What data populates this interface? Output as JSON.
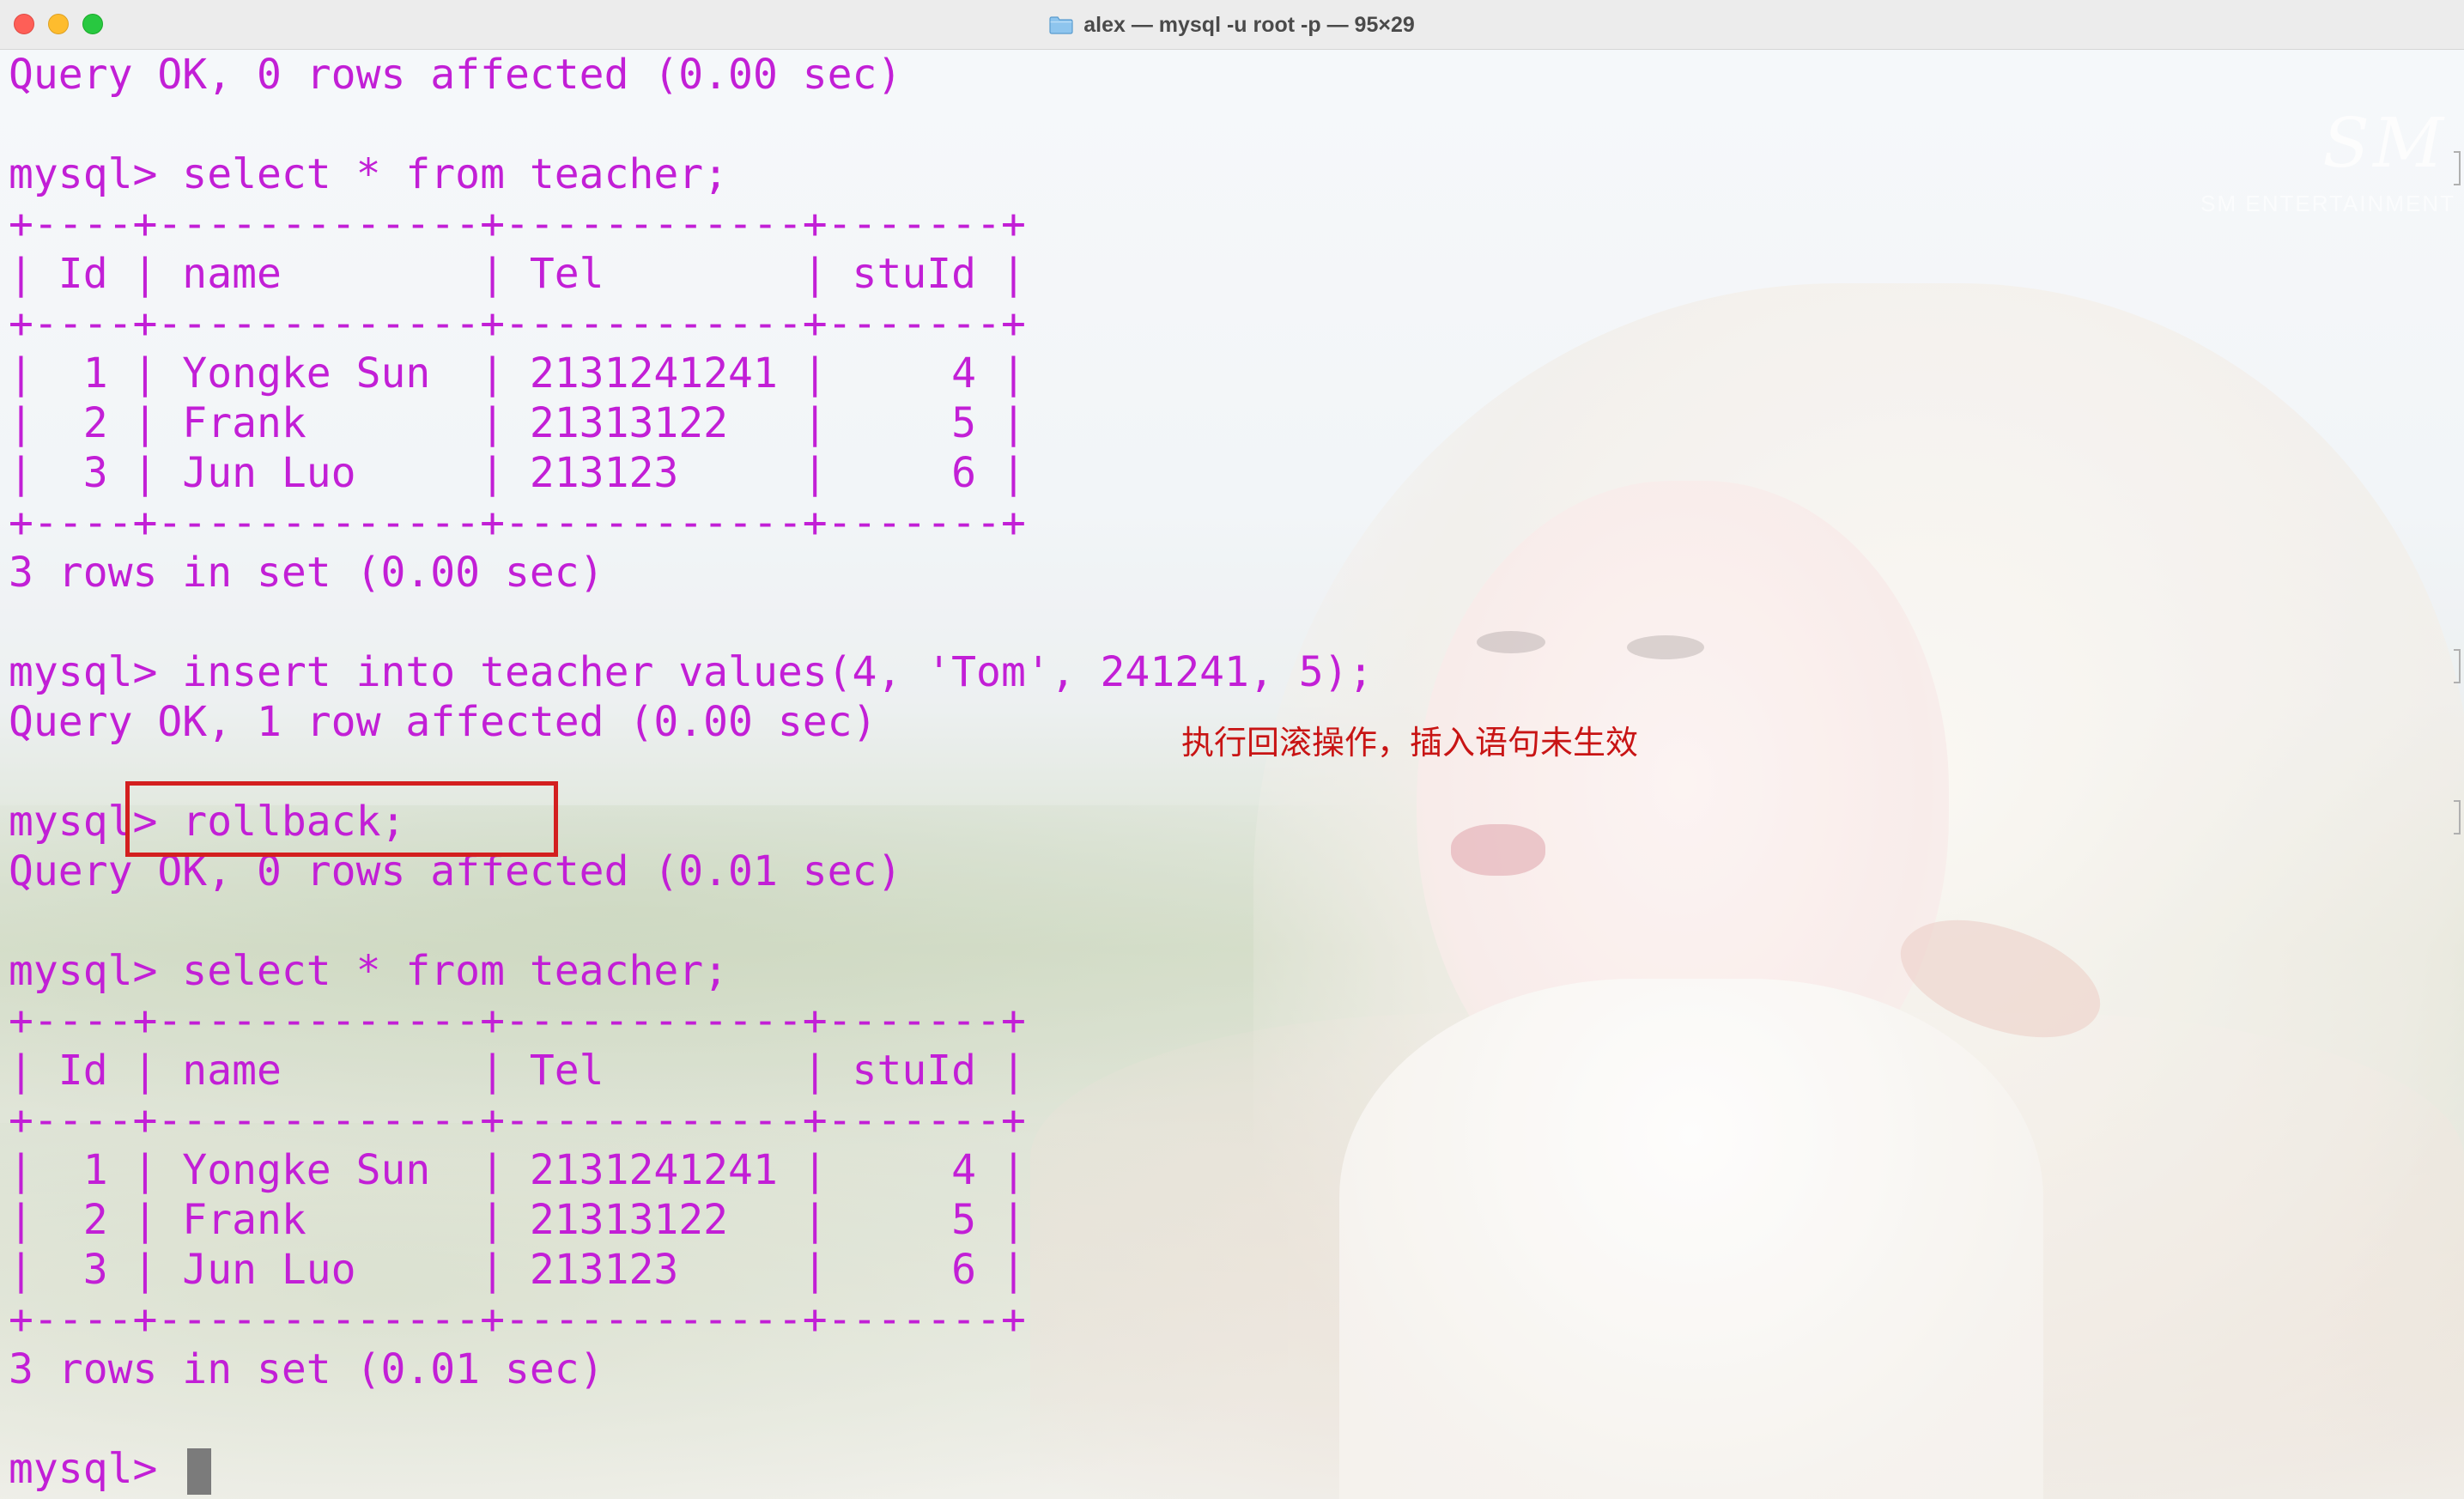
{
  "window": {
    "title": "alex — mysql -u root -p — 95×29"
  },
  "terminal": {
    "lines": [
      "Query OK, 0 rows affected (0.00 sec)",
      "",
      "mysql> select * from teacher;",
      "+----+-------------+------------+-------+",
      "| Id | name        | Tel        | stuId |",
      "+----+-------------+------------+-------+",
      "|  1 | Yongke Sun  | 2131241241 |     4 |",
      "|  2 | Frank       | 21313122   |     5 |",
      "|  3 | Jun Luo     | 213123     |     6 |",
      "+----+-------------+------------+-------+",
      "3 rows in set (0.00 sec)",
      "",
      "mysql> insert into teacher values(4, 'Tom', 241241, 5);",
      "Query OK, 1 row affected (0.00 sec)",
      "",
      "mysql> rollback;",
      "Query OK, 0 rows affected (0.01 sec)",
      "",
      "mysql> select * from teacher;",
      "+----+-------------+------------+-------+",
      "| Id | name        | Tel        | stuId |",
      "+----+-------------+------------+-------+",
      "|  1 | Yongke Sun  | 2131241241 |     4 |",
      "|  2 | Frank       | 21313122   |     5 |",
      "|  3 | Jun Luo     | 213123     |     6 |",
      "+----+-------------+------------+-------+",
      "3 rows in set (0.01 sec)",
      "",
      "mysql> "
    ],
    "text_color": "#c21fd6"
  },
  "annotation": {
    "text": "执行回滚操作，插入语句未生效",
    "color": "#c81414"
  },
  "background": {
    "watermark": "SM",
    "watermark_sub": "SM ENTERTAINMENT"
  },
  "icons": {
    "title": "folder-icon"
  }
}
